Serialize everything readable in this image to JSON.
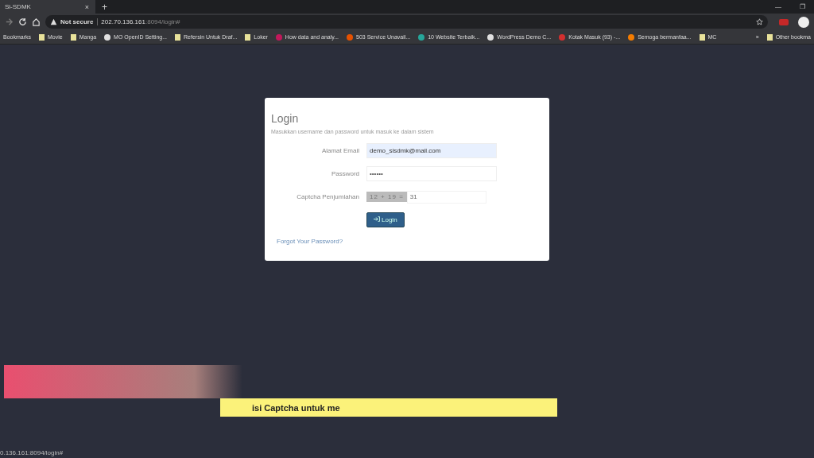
{
  "tab": {
    "title": "Si-SDMK",
    "close": "×",
    "new_tab": "+"
  },
  "window_controls": {
    "minimize": "—",
    "restore": "❐"
  },
  "address_bar": {
    "security": "Not secure",
    "host": "202.70.136.161",
    "path": ":8094/login#"
  },
  "bookmarks": [
    {
      "label": "Bookmarks",
      "kind": "text"
    },
    {
      "label": "Movie",
      "kind": "folder"
    },
    {
      "label": "Manga",
      "kind": "folder"
    },
    {
      "label": "MO OpenID Setting...",
      "kind": "site",
      "color": "#e0e0e0"
    },
    {
      "label": "Refersin Untuk Draf...",
      "kind": "folder"
    },
    {
      "label": "Loker",
      "kind": "folder"
    },
    {
      "label": "How data and analy...",
      "kind": "site",
      "color": "#c2185b"
    },
    {
      "label": "503 Service Unavail...",
      "kind": "site",
      "color": "#e65100"
    },
    {
      "label": "10 Website Terbaik...",
      "kind": "site",
      "color": "#26a69a"
    },
    {
      "label": "WordPress Demo C...",
      "kind": "site",
      "color": "#e0e0e0"
    },
    {
      "label": "Kotak Masuk (93) -...",
      "kind": "site",
      "color": "#d32f2f"
    },
    {
      "label": "Semoga bermanfaa...",
      "kind": "site",
      "color": "#f57c00"
    },
    {
      "label": "MC",
      "kind": "folder"
    }
  ],
  "bookmarks_more": "»",
  "other_bookmarks": "Other bookma",
  "login": {
    "title": "Login",
    "subtitle": "Masukkan username dan password untuk masuk ke dalam sistem",
    "fields": [
      {
        "label": "Alamat Email",
        "value": "demo_sisdmk@mail.com",
        "kind": "email"
      },
      {
        "label": "Password",
        "value": "••••••",
        "kind": "password"
      },
      {
        "label": "Captcha Penjumlahan",
        "captcha": "12 + 19 =",
        "value": "31",
        "kind": "captcha"
      }
    ],
    "button": "Login",
    "forgot": "Forgot Your Password?"
  },
  "caption": "isi Captcha untuk me",
  "status_url": "0.136.161:8094/login#"
}
